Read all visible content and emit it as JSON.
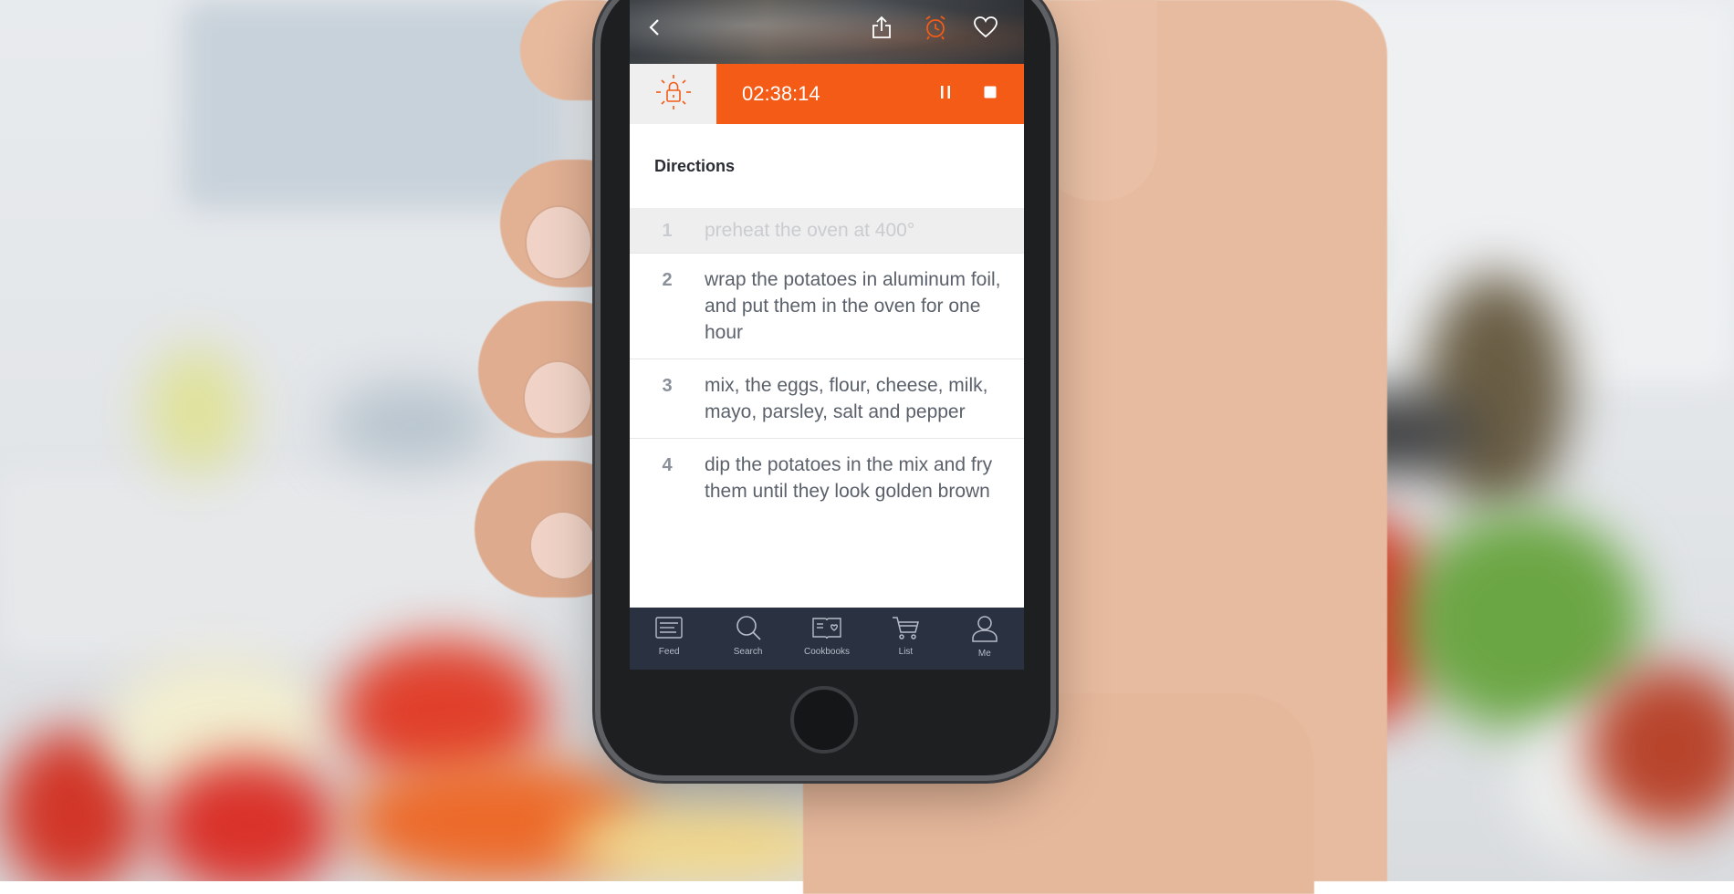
{
  "header": {
    "icons": [
      "back-icon",
      "share-icon",
      "alarm-icon",
      "heart-icon"
    ]
  },
  "timer": {
    "time": "02:38:14",
    "lock_icon": "lock-icon",
    "accent": "#f35b17"
  },
  "directions": {
    "title": "Directions",
    "steps": [
      {
        "num": "1",
        "text": "preheat the oven at 400°",
        "done": true
      },
      {
        "num": "2",
        "text": "wrap the potatoes in aluminum foil, and put them in the oven for one hour",
        "done": false
      },
      {
        "num": "3",
        "text": "mix, the eggs, flour, cheese, milk, mayo, parsley, salt and pepper",
        "done": false
      },
      {
        "num": "4",
        "text": "dip the potatoes in the mix and fry them until they look golden brown",
        "done": false
      }
    ]
  },
  "tabbar": {
    "tabs": [
      {
        "label": "Feed",
        "icon": "feed-icon"
      },
      {
        "label": "Search",
        "icon": "search-icon"
      },
      {
        "label": "Cookbooks",
        "icon": "cookbook-icon"
      },
      {
        "label": "List",
        "icon": "cart-icon"
      },
      {
        "label": "Me",
        "icon": "user-icon"
      }
    ]
  }
}
